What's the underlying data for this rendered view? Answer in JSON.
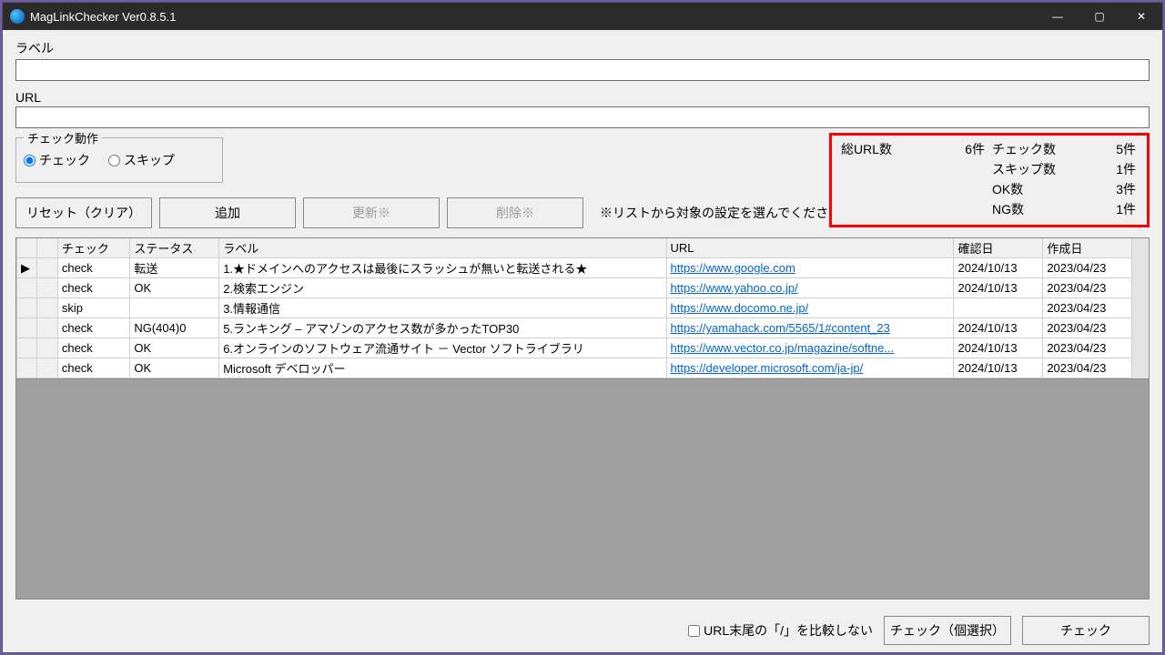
{
  "title": "MagLinkChecker Ver0.8.5.1",
  "labels": {
    "label_field": "ラベル",
    "url_field": "URL",
    "check_action_legend": "チェック動作",
    "radio_check": "チェック",
    "radio_skip": "スキップ",
    "btn_reset": "リセット（クリア）",
    "btn_add": "追加",
    "btn_update": "更新※",
    "btn_delete": "削除※",
    "hint": "※リストから対象の設定を選んでください",
    "chk_trailing": "URL末尾の「/」を比較しない",
    "btn_check_selected": "チェック（個選択）",
    "btn_check": "チェック"
  },
  "stats": {
    "total_url_label": "総URL数",
    "total_url_value": "6件",
    "check_count_label": "チェック数",
    "check_count_value": "5件",
    "skip_count_label": "スキップ数",
    "skip_count_value": "1件",
    "ok_count_label": "OK数",
    "ok_count_value": "3件",
    "ng_count_label": "NG数",
    "ng_count_value": "1件"
  },
  "columns": {
    "c_check": "チェック",
    "c_status": "ステータス",
    "c_label": "ラベル",
    "c_url": "URL",
    "c_confirm": "確認日",
    "c_create": "作成日"
  },
  "rows": [
    {
      "sel": "▶",
      "check": "check",
      "status": "転送",
      "label": "1.★ドメインへのアクセスは最後にスラッシュが無いと転送される★",
      "url": "https://www.google.com",
      "confirm": "2024/10/13",
      "create": "2023/04/23"
    },
    {
      "sel": "",
      "check": "check",
      "status": "OK",
      "label": "2.検索エンジン",
      "url": "https://www.yahoo.co.jp/",
      "confirm": "2024/10/13",
      "create": "2023/04/23"
    },
    {
      "sel": "",
      "check": "skip",
      "status": "",
      "label": "3.情報通信",
      "url": "https://www.docomo.ne.jp/",
      "confirm": "",
      "create": "2023/04/23"
    },
    {
      "sel": "",
      "check": "check",
      "status": "NG(404)0",
      "label": "5.ランキング – アマゾンのアクセス数が多かったTOP30",
      "url": "https://yamahack.com/5565/1#content_23",
      "confirm": "2024/10/13",
      "create": "2023/04/23"
    },
    {
      "sel": "",
      "check": "check",
      "status": "OK",
      "label": "6.オンラインのソフトウェア流通サイト － Vector ソフトライブラリ",
      "url": "https://www.vector.co.jp/magazine/softne...",
      "confirm": "2024/10/13",
      "create": "2023/04/23"
    },
    {
      "sel": "",
      "check": "check",
      "status": "OK",
      "label": "Microsoft デベロッパー",
      "url": "https://developer.microsoft.com/ja-jp/",
      "confirm": "2024/10/13",
      "create": "2023/04/23"
    }
  ]
}
